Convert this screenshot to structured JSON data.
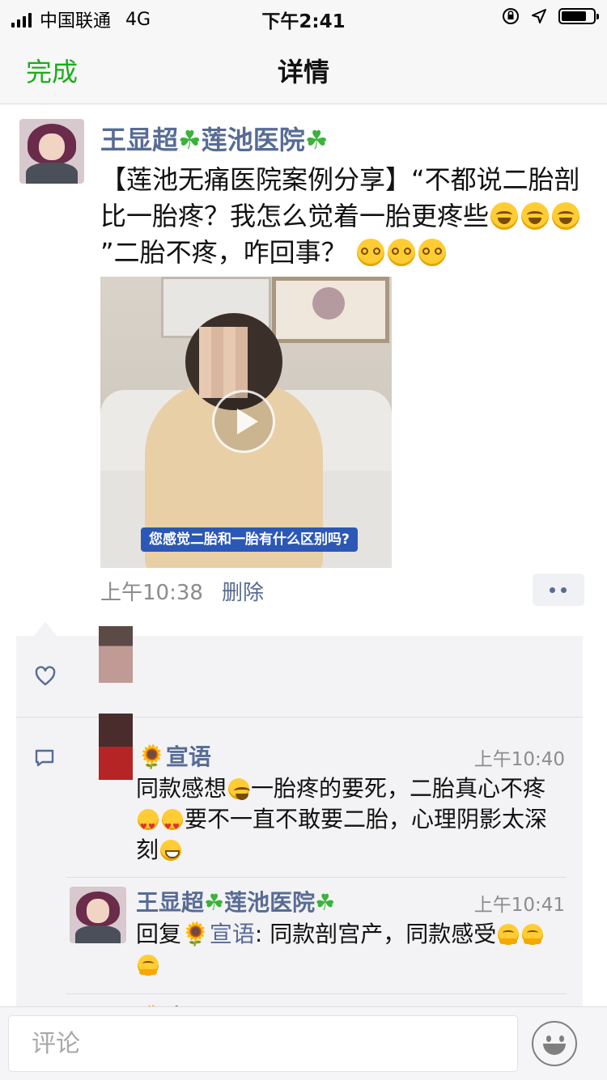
{
  "status": {
    "carrier": "中国联通",
    "network": "4G",
    "time": "下午2:41"
  },
  "nav": {
    "done_label": "完成",
    "title": "详情"
  },
  "post": {
    "author_name": "王显超",
    "author_org": "莲池医院",
    "text_part1": "【莲池无痛医院案例分享】“不都说二胎剖比一胎疼？我怎么觉着一胎更疼些",
    "text_part2": "”二胎不疼，咋回事？",
    "video_caption": "您感觉二胎和一胎有什么区别吗?",
    "time": "上午10:38",
    "delete_label": "删除"
  },
  "comments": [
    {
      "name": "宣语",
      "time": "上午10:40",
      "text_a": "同款感想",
      "text_b": "一胎疼的要死，二胎真心不疼",
      "text_c": "要不一直不敢要二胎，心理阴影太深刻"
    },
    {
      "name_author": "王显超",
      "name_org": "莲池医院",
      "time": "上午10:41",
      "reply_prefix": "回复",
      "reply_to": "宣语",
      "text": ": 同款剖宫产，同款感受"
    }
  ],
  "third_comment_peek": "宣语",
  "input": {
    "placeholder": "评论"
  },
  "colors": {
    "accent_green": "#1aad19",
    "link_blue": "#576b95",
    "panel_bg": "#f3f3f5"
  }
}
